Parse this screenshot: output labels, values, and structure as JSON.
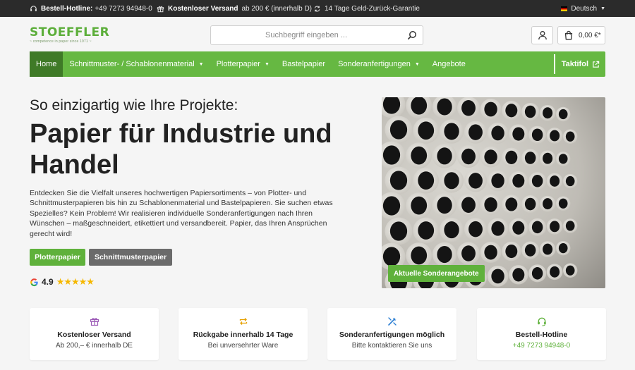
{
  "topbar": {
    "hotline_label": "Bestell-Hotline:",
    "hotline_number": "+49 7273 94948-0",
    "shipping_bold": "Kostenloser Versand",
    "shipping_rest": "ab 200 € (innerhalb D)",
    "guarantee": "14 Tage Geld-Zurück-Garantie",
    "language": "Deutsch"
  },
  "header": {
    "logo": "STOEFFLER",
    "logo_tagline": "~ competence in paper since 1971 ~",
    "search_placeholder": "Suchbegriff eingeben ...",
    "cart_total": "0,00 €*"
  },
  "nav": {
    "items": [
      {
        "label": "Home"
      },
      {
        "label": "Schnittmuster- / Schablonenmaterial"
      },
      {
        "label": "Plotterpapier"
      },
      {
        "label": "Bastelpapier"
      },
      {
        "label": "Sonderanfertigungen"
      },
      {
        "label": "Angebote"
      }
    ],
    "special": "Taktifol"
  },
  "hero": {
    "kicker": "So einzigartig wie Ihre Projekte:",
    "headline": "Papier für Industrie und Handel",
    "intro": "Entdecken Sie die Vielfalt unseres hochwertigen Papiersortiments – von Plotter- und Schnittmusterpapieren bis hin zu Schablonenmaterial und Bastelpapieren. Sie suchen etwas Spezielles? Kein Problem! Wir realisieren individuelle Sonderanfertigungen nach Ihren Wünschen – maßgeschneidert, etikettiert und versandbereit. Papier, das Ihren Ansprüchen gerecht wird!",
    "button_primary": "Plotterpapier",
    "button_secondary": "Schnittmusterpapier",
    "rating": "4.9",
    "stars": "★★★★★",
    "image_badge": "Aktuelle Sonderangebote"
  },
  "features": [
    {
      "title": "Kostenloser Versand",
      "sub": "Ab 200,– € innerhalb DE"
    },
    {
      "title": "Rückgabe innerhalb 14 Tage",
      "sub": "Bei unversehrter Ware"
    },
    {
      "title": "Sonderanfertigungen möglich",
      "sub": "Bitte kontaktieren Sie uns"
    },
    {
      "title": "Bestell-Hotline",
      "sub": "+49 7273 94948-0"
    }
  ],
  "colors": {
    "brand_green": "#66b842",
    "nav_active": "#3f7a27",
    "topbar": "#2b2b2b",
    "star": "#f5b800",
    "gift_icon": "#9b59b6",
    "return_icon": "#e6a100",
    "tools_icon": "#2d7fd3",
    "headset_icon": "#5fb13b"
  }
}
